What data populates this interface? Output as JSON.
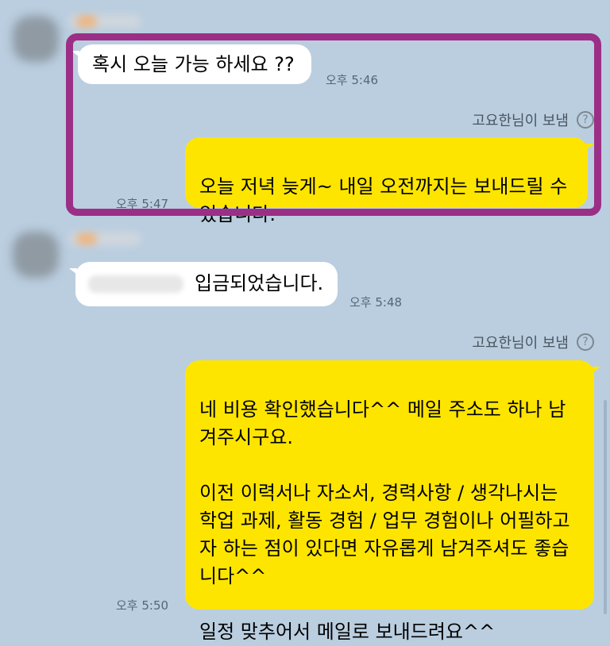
{
  "messages": [
    {
      "id": "m1",
      "text": "혹시 오늘 가능 하세요 ??",
      "time": "오후 5:46"
    },
    {
      "id": "m2",
      "text": "오늘 저녁 늦게~ 내일 오전까지는 보내드릴 수\n있습니다.",
      "time": "오후 5:47"
    },
    {
      "id": "m3",
      "text": "입금되었습니다.",
      "time": "오후 5:48"
    },
    {
      "id": "m4",
      "text": "네 비용 확인했습니다^^ 메일 주소도 하나 남\n겨주시구요.\n\n이전 이력서나 자소서, 경력사항 / 생각나시는\n학업 과제, 활동 경험 / 업무 경험이나 어필하고\n자 하는 점이 있다면 자유롭게 남겨주셔도 좋습\n니다^^\n\n일정 맞추어서 메일로 보내드려요^^",
      "time": "오후 5:50"
    }
  ],
  "sender_label": "고요한님이 보냄",
  "help_icon": "?",
  "colors": {
    "background": "#bacee0",
    "incoming_bubble": "#ffffff",
    "outgoing_bubble": "#fee500",
    "highlight": "#9b2f86"
  }
}
